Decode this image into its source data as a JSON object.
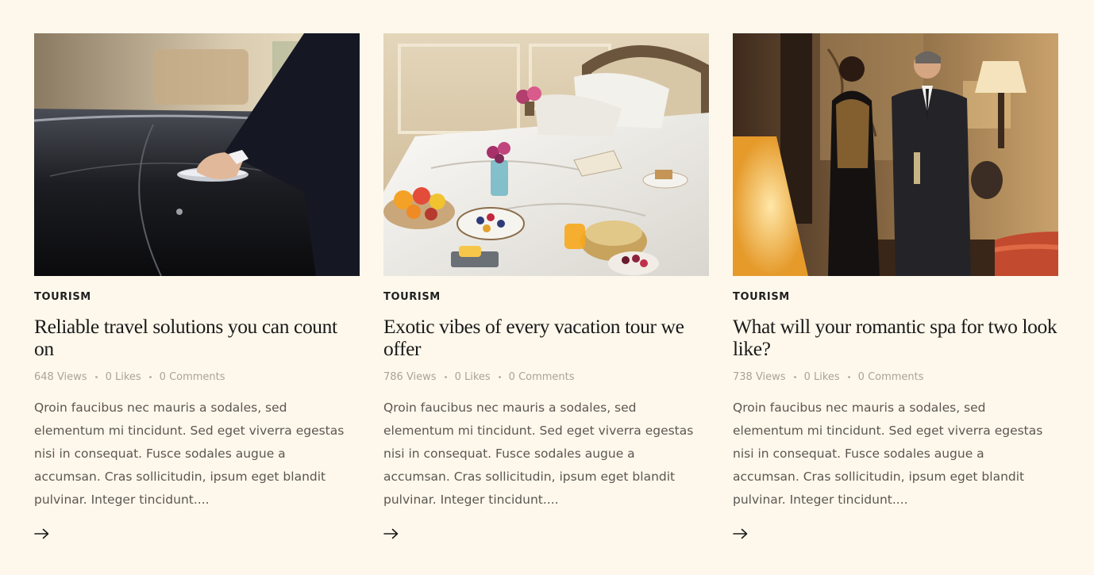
{
  "posts": [
    {
      "category": "TOURISM",
      "title": "Reliable travel solutions you can count on",
      "views": "648 Views",
      "likes": "0 Likes",
      "comments": "0 Comments",
      "excerpt": "Qroin faucibus nec mauris a sodales, sed elementum mi tincidunt. Sed eget viverra egestas nisi in consequat. Fusce sodales augue a accumsan. Cras sollicitudin, ipsum eget blandit pulvinar. Integer tincidunt....",
      "image": "chauffeur-car-door-photo"
    },
    {
      "category": "TOURISM",
      "title": "Exotic vibes of every vacation tour we offer",
      "views": "786 Views",
      "likes": "0 Likes",
      "comments": "0 Comments",
      "excerpt": "Qroin faucibus nec mauris a sodales, sed elementum mi tincidunt. Sed eget viverra egestas nisi in consequat. Fusce sodales augue a accumsan. Cras sollicitudin, ipsum eget blandit pulvinar. Integer tincidunt....",
      "image": "hotel-bed-breakfast-photo"
    },
    {
      "category": "TOURISM",
      "title": "What will your romantic spa for two look like?",
      "views": "738 Views",
      "likes": "0 Likes",
      "comments": "0 Comments",
      "excerpt": "Qroin faucibus nec mauris a sodales, sed elementum mi tincidunt. Sed eget viverra egestas nisi in consequat. Fusce sodales augue a accumsan. Cras sollicitudin, ipsum eget blandit pulvinar. Integer tincidunt....",
      "image": "couple-luxury-lounge-photo"
    }
  ],
  "icons": {
    "read_more": "arrow-right-icon"
  },
  "colors": {
    "background": "#fef8ec",
    "title": "#1a1a1a",
    "meta": "#a8a29a",
    "excerpt": "#5b5651"
  }
}
